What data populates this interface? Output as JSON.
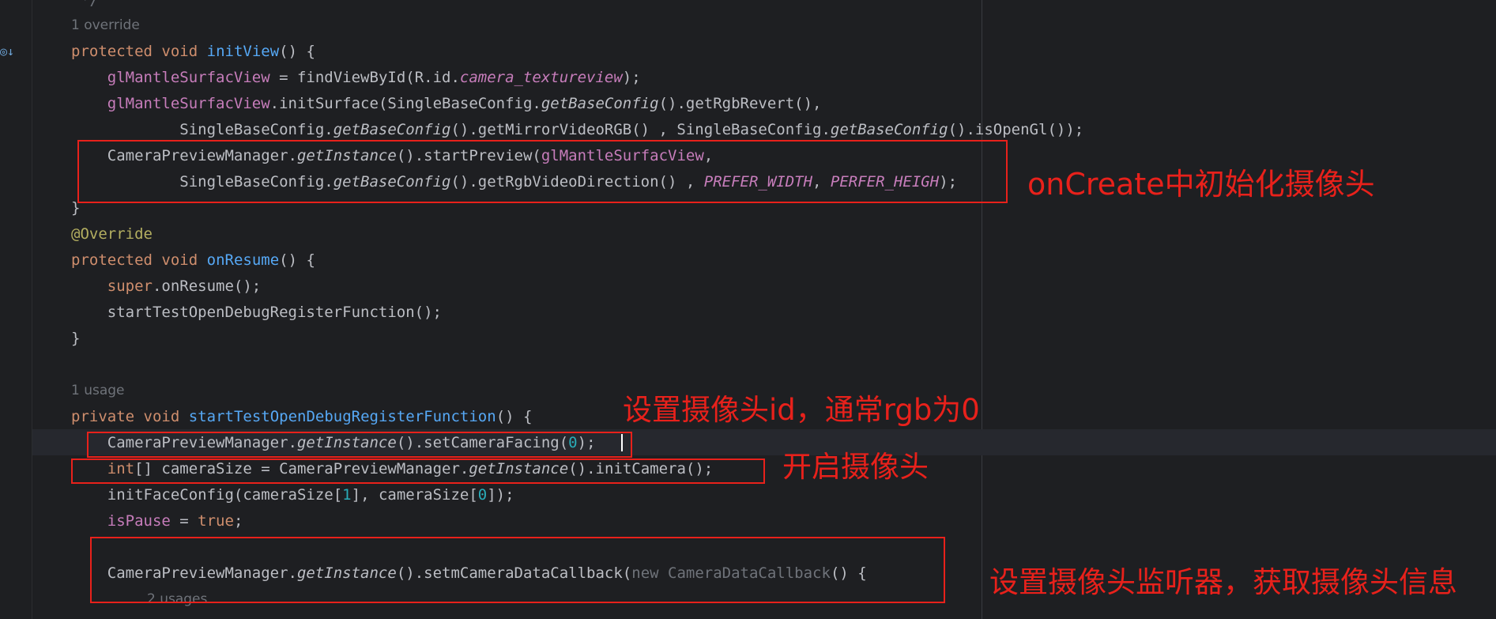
{
  "editor": {
    "top_fragment": "*/",
    "hint_override": "1 override",
    "hint_usage": "1 usage",
    "hint_usages": "2 usages",
    "lines": {
      "l1": [
        "protected",
        " ",
        "void",
        " ",
        "initView",
        "() {"
      ],
      "l2": [
        "    ",
        "glMantleSurfacView",
        " = findViewById(R.id.",
        "camera_textureview",
        ");"
      ],
      "l3": [
        "    ",
        "glMantleSurfacView",
        ".initSurface(SingleBaseConfig.",
        "getBaseConfig",
        "().getRgbRevert(),"
      ],
      "l4": [
        "            SingleBaseConfig.",
        "getBaseConfig",
        "().getMirrorVideoRGB() , SingleBaseConfig.",
        "getBaseConfig",
        "().isOpenGl());"
      ],
      "l5": [
        "    CameraPreviewManager.",
        "getInstance",
        "().startPreview(",
        "glMantleSurfacView",
        ","
      ],
      "l6": [
        "            SingleBaseConfig.",
        "getBaseConfig",
        "().getRgbVideoDirection() , ",
        "PREFER_WIDTH",
        ", ",
        "PERFER_HEIGH",
        ");"
      ],
      "l7": [
        "}"
      ],
      "l8": [
        "@Override"
      ],
      "l9": [
        "protected",
        " ",
        "void",
        " ",
        "onResume",
        "() {"
      ],
      "l10": [
        "    ",
        "super",
        ".onResume();"
      ],
      "l11": [
        "    startTestOpenDebugRegisterFunction();"
      ],
      "l12": [
        "}"
      ],
      "l13": [
        "private",
        " ",
        "void",
        " ",
        "startTestOpenDebugRegisterFunction",
        "() {"
      ],
      "l14": [
        "    CameraPreviewManager.",
        "getInstance",
        "().setCameraFacing(",
        "0",
        ");"
      ],
      "l15": [
        "    ",
        "int",
        "[] cameraSize = CameraPreviewManager.",
        "getInstance",
        "().initCamera();"
      ],
      "l16": [
        "    initFaceConfig(cameraSize[",
        "1",
        "], cameraSize[",
        "0",
        "]);"
      ],
      "l17": [
        "    ",
        "isPause",
        " = ",
        "true",
        ";"
      ],
      "l18": [
        "    CameraPreviewManager.",
        "getInstance",
        "().setmCameraDataCallback(",
        "new",
        " ",
        "CameraDataCallback",
        "() {"
      ]
    }
  },
  "annotations": {
    "oncreate": "onCreate中初始化摄像头",
    "camera_id": "设置摄像头id，通常rgb为0",
    "open_camera": "开启摄像头",
    "listener": "设置摄像头监听器，获取摄像头信息"
  },
  "colors": {
    "annotation_red": "#e8211b",
    "background": "#1e1f22",
    "keyword": "#cf8e6d",
    "method": "#56a8f5",
    "field": "#c77dbb",
    "number": "#2aacb8"
  },
  "icons": {
    "gutter": "override-method-icon"
  }
}
